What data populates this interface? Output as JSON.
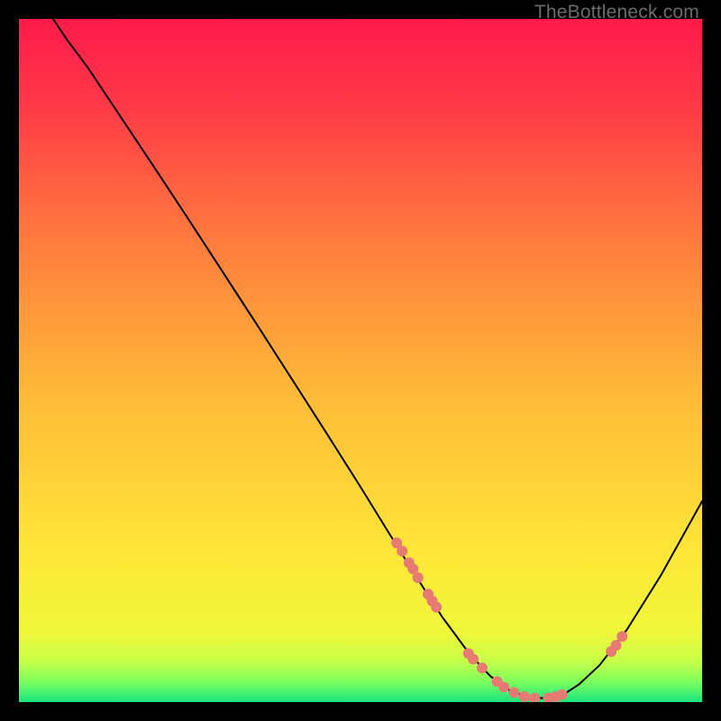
{
  "watermark": "TheBottleneck.com",
  "chart_data": {
    "type": "line",
    "title": "",
    "xlabel": "",
    "ylabel": "",
    "xlim": [
      0,
      100
    ],
    "ylim": [
      0,
      100
    ],
    "grid": false,
    "legend": false,
    "background_gradient": {
      "top_color": "#ff1a4b",
      "mid_color": "#ffe638",
      "bottom_colors": [
        "#d4ff3a",
        "#7dff5e",
        "#19e57e"
      ]
    },
    "series": [
      {
        "name": "curve",
        "x": [
          5,
          7,
          10,
          15,
          20,
          25,
          30,
          35,
          40,
          45,
          50,
          54,
          58,
          62,
          66,
          69,
          72,
          75,
          78,
          80,
          82,
          85,
          89,
          94,
          100
        ],
        "y": [
          100,
          97,
          93,
          85.5,
          78,
          70.4,
          62.7,
          55,
          47.2,
          39.4,
          31.5,
          25,
          18.6,
          12.4,
          7.0,
          3.8,
          1.6,
          0.6,
          0.6,
          1.3,
          2.6,
          5.4,
          10.6,
          18.6,
          29.4
        ],
        "stroke": "#000000",
        "stroke_width": 2
      }
    ],
    "markers": [
      {
        "name": "dots-left-cluster",
        "points": [
          [
            55.3,
            23.3
          ],
          [
            56.1,
            22.1
          ],
          [
            57.1,
            20.4
          ],
          [
            57.7,
            19.5
          ],
          [
            58.4,
            18.2
          ],
          [
            59.9,
            15.8
          ],
          [
            60.5,
            14.8
          ],
          [
            61.1,
            13.9
          ]
        ],
        "color": "#e77b74",
        "r": 6
      },
      {
        "name": "dots-valley-cluster",
        "points": [
          [
            65.8,
            7.1
          ],
          [
            66.5,
            6.3
          ],
          [
            67.8,
            5.0
          ],
          [
            70.0,
            3.0
          ],
          [
            71.0,
            2.2
          ],
          [
            72.5,
            1.4
          ],
          [
            74.0,
            0.8
          ],
          [
            75.5,
            0.6
          ],
          [
            77.5,
            0.6
          ],
          [
            78.6,
            0.8
          ],
          [
            79.5,
            1.1
          ]
        ],
        "color": "#e77b74",
        "r": 6
      },
      {
        "name": "dots-right-cluster",
        "points": [
          [
            86.7,
            7.4
          ],
          [
            87.4,
            8.3
          ],
          [
            88.3,
            9.6
          ]
        ],
        "color": "#e77b74",
        "r": 6
      }
    ]
  }
}
